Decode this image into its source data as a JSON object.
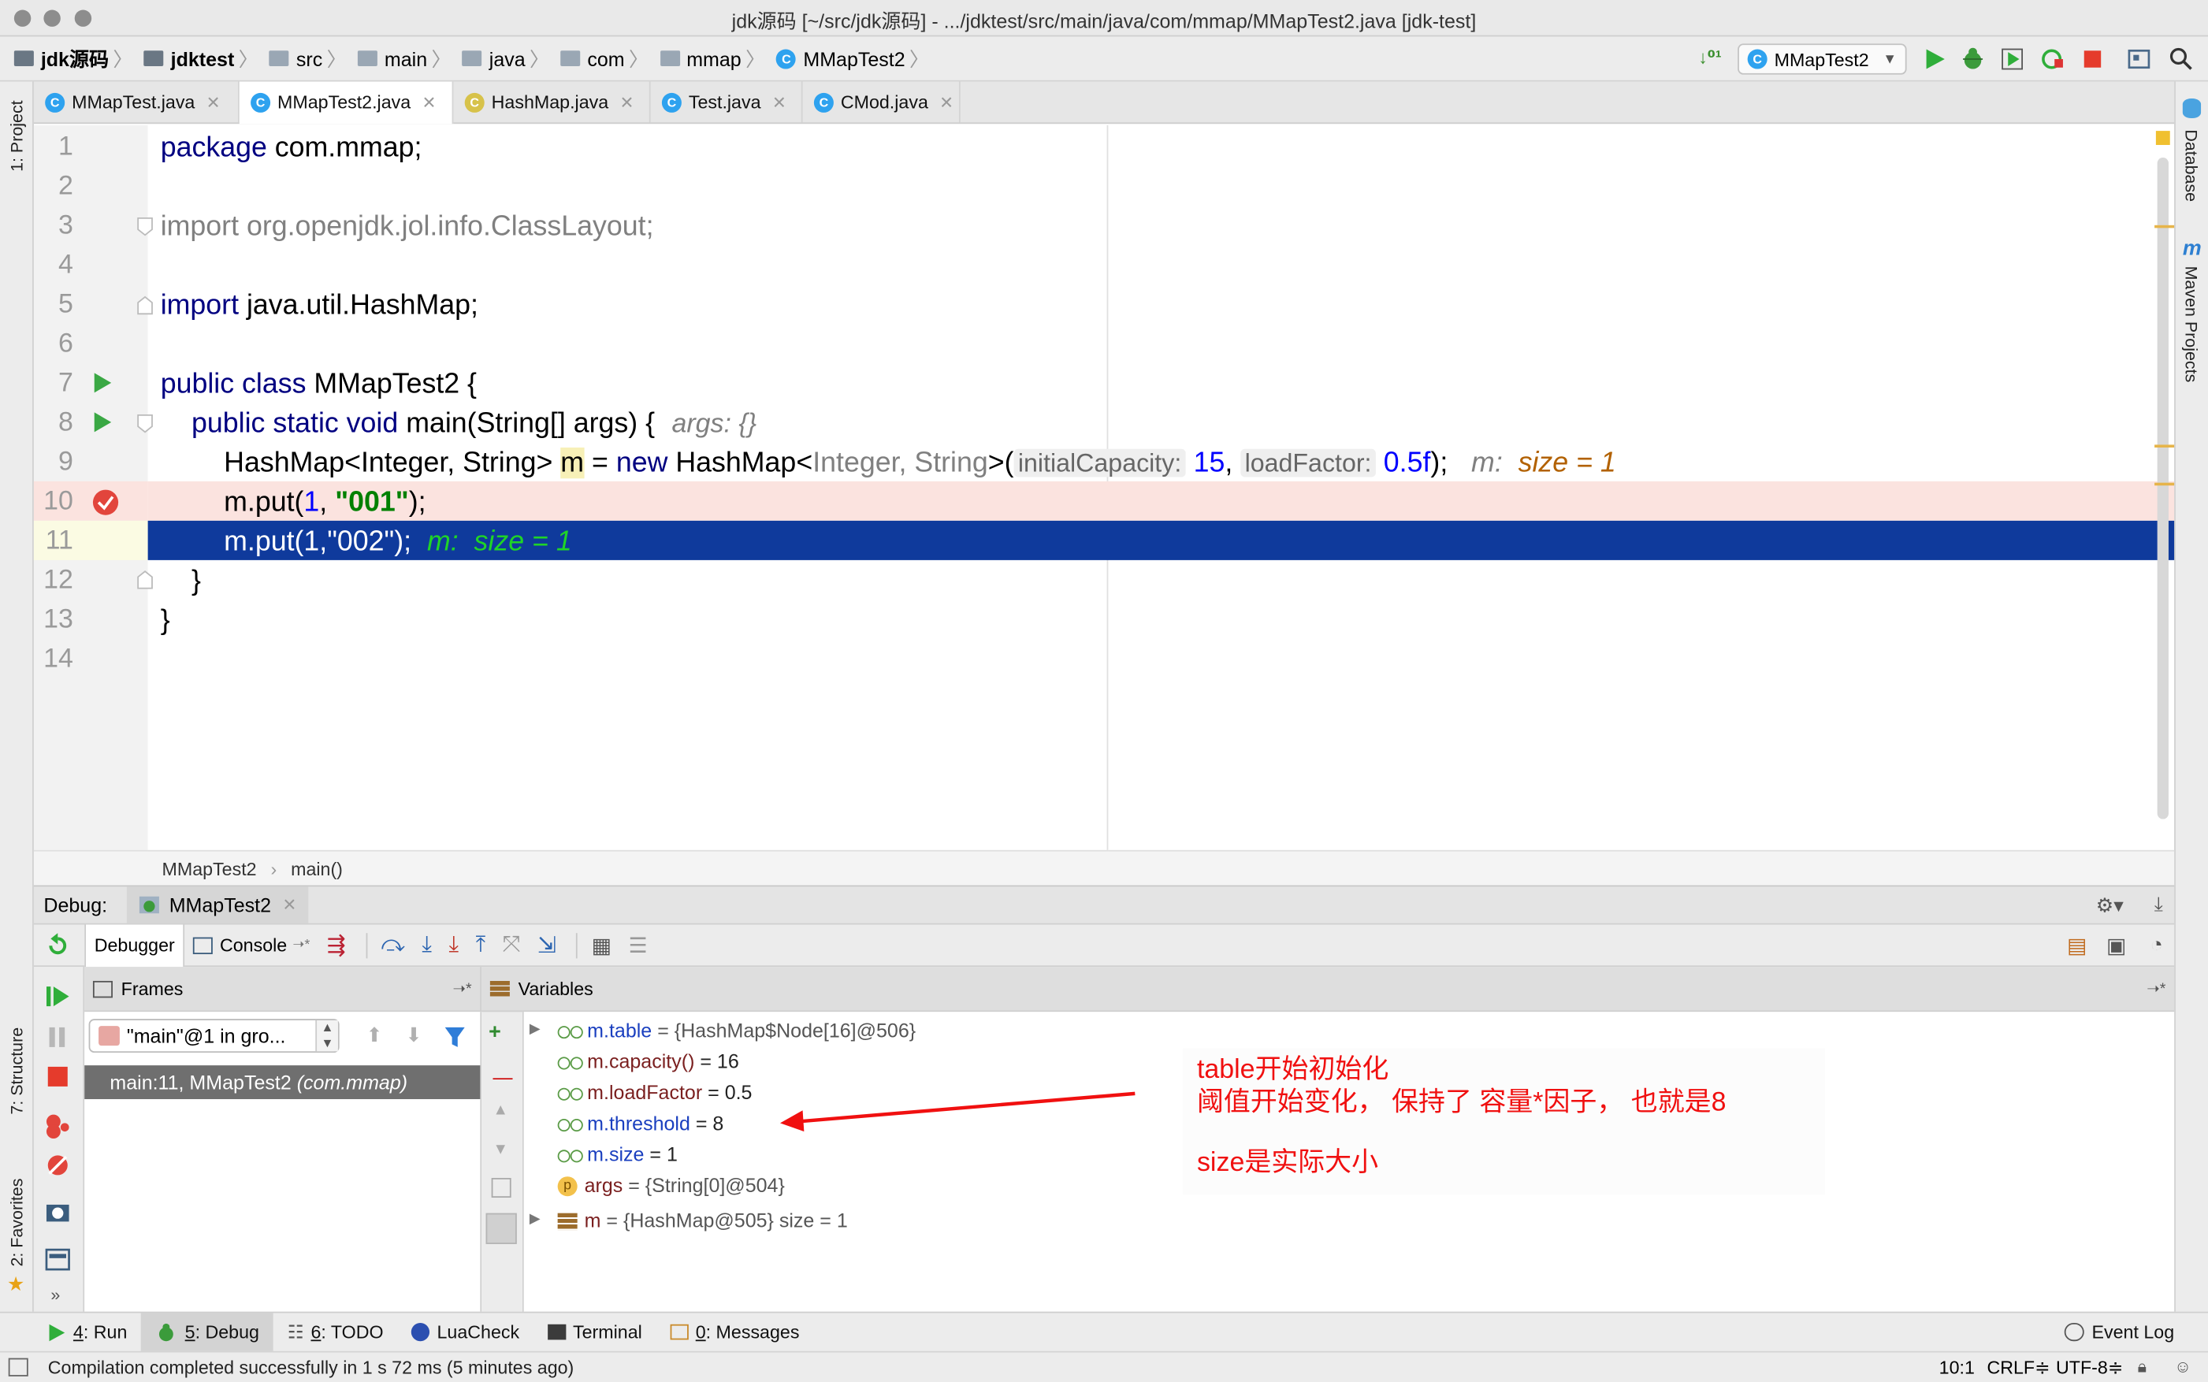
{
  "window": {
    "title": "jdk源码 [~/src/jdk源码] - .../jdktest/src/main/java/com/mmap/MMapTest2.java [jdk-test]"
  },
  "navbar": {
    "crumbs": [
      "jdk源码",
      "jdktest",
      "src",
      "main",
      "java",
      "com",
      "mmap",
      "MMapTest2"
    ],
    "run_config": "MMapTest2"
  },
  "tabs": [
    {
      "label": "MMapTest.java",
      "icon": "C"
    },
    {
      "label": "MMapTest2.java",
      "icon": "C"
    },
    {
      "label": "HashMap.java",
      "icon": "C"
    },
    {
      "label": "Test.java",
      "icon": "C"
    },
    {
      "label": "CMod.java",
      "icon": "C"
    }
  ],
  "left_strip": {
    "project": "1: Project",
    "structure": "7: Structure",
    "favorites": "2: Favorites"
  },
  "right_strip": {
    "database": "Database",
    "maven": "Maven Projects"
  },
  "editor": {
    "line_numbers": [
      "1",
      "2",
      "3",
      "4",
      "5",
      "6",
      "7",
      "8",
      "9",
      "10",
      "11",
      "12",
      "13",
      "14"
    ],
    "l1": {
      "kw": "package",
      "rest": " com.mmap;"
    },
    "l3": {
      "text": "import org.openjdk.jol.info.ClassLayout;"
    },
    "l5": {
      "kw": "import",
      "rest": " java.util.HashMap;"
    },
    "l7": {
      "kw": "public class",
      "rest": " MMapTest2 {"
    },
    "l8": {
      "kw": "public static void",
      "rest": " main(String[] args) {",
      "hint": "args: {}"
    },
    "l9": {
      "a": "HashMap<Integer, String> ",
      "var": "m",
      "b": " = ",
      "kw": "new",
      "c": " HashMap<",
      "d": "Integer, String",
      "e": ">(",
      "h1": "initialCapacity:",
      "n1": "15",
      "f": ", ",
      "h2": "loadFactor:",
      "n2": "0.5f",
      "g": ");",
      "inl_a": "m:",
      "inl_b": "size = 1"
    },
    "l10": {
      "a": "m.put(",
      "n": "1",
      "b": ", ",
      "s": "\"001\"",
      "c": ");"
    },
    "l11": {
      "code": "m.put(1,\"002\");",
      "inl_a": "m:",
      "inl_b": "size = 1"
    },
    "l12": {
      "text": "}"
    },
    "l13": {
      "text": "}"
    }
  },
  "breadcrumb2": {
    "cls": "MMapTest2",
    "method": "main()"
  },
  "debug": {
    "label": "Debug:",
    "session": "MMapTest2",
    "tab_debugger": "Debugger",
    "tab_console": "Console",
    "frames_title": "Frames",
    "variables_title": "Variables",
    "thread": "\"main\"@1 in gro...",
    "frame_a": "main:11, MMapTest2",
    "frame_b": "(com.mmap)",
    "vars": [
      {
        "name": "m.table",
        "val": " = {HashMap$Node[16]@506}"
      },
      {
        "name": "m.capacity()",
        "val": " = 16"
      },
      {
        "name": "m.loadFactor",
        "val": " = 0.5"
      },
      {
        "name": "m.threshold",
        "val": " = 8"
      },
      {
        "name": "m.size",
        "val": " = 1"
      },
      {
        "name": "args",
        "val": " = {String[0]@504}"
      },
      {
        "name": "m",
        "val": " = {HashMap@505}  size = 1"
      }
    ]
  },
  "annotation": {
    "line1": "table开始初始化",
    "line2": "阈值开始变化，  保持了   容量*因子，  也就是8",
    "line3": "size是实际大小",
    "color": "#f01010"
  },
  "bottom_tools": [
    {
      "num": "4",
      "label": ": Run"
    },
    {
      "num": "5",
      "label": ": Debug"
    },
    {
      "num": "6",
      "label": ": TODO"
    },
    {
      "num": "",
      "label": "LuaCheck"
    },
    {
      "num": "",
      "label": "Terminal"
    },
    {
      "num": "0",
      "label": ": Messages"
    }
  ],
  "event_log": "Event Log",
  "status": {
    "message": "Compilation completed successfully in 1 s 72 ms (5 minutes ago)",
    "position": "10:1",
    "line_sep": "CRLF≑",
    "encoding": "UTF-8≑"
  }
}
